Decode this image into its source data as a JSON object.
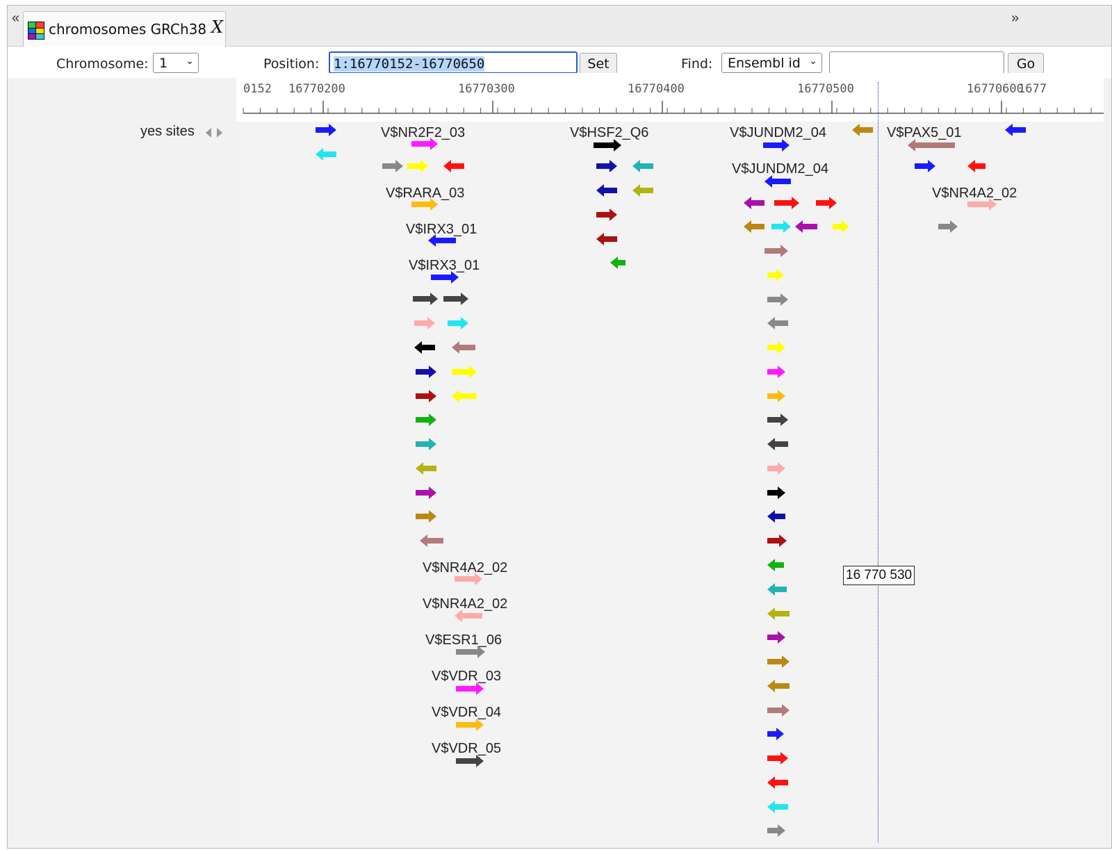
{
  "tab_bar": {
    "scroll_left": "«",
    "scroll_right": "»",
    "tab_title": "chromosomes GRCh38",
    "tab_close": "X"
  },
  "toolbar": {
    "chromosome_label": "Chromosome:",
    "chromosome_value": "1",
    "position_label": "Position:",
    "position_value": "1:16770152-16770650",
    "set_label": "Set",
    "find_label": "Find:",
    "find_type": "Ensembl id",
    "find_value": "",
    "go_label": "Go"
  },
  "ruler": {
    "ticks": [
      "0152",
      "16770200",
      "16770300",
      "16770400",
      "16770500",
      "16770600",
      "1677"
    ]
  },
  "track": {
    "label": "yes sites",
    "marker_label": "16 770 530"
  },
  "site_labels": [
    "V$NR2F2_03",
    "V$HSF2_Q6",
    "V$JUNDM2_04",
    "V$PAX5_01",
    "V$JUNDM2_04",
    "V$RARA_03",
    "V$NR4A2_02",
    "V$IRX3_01",
    "V$IRX3_01",
    "V$NR4A2_02",
    "V$NR4A2_02",
    "V$ESR1_06",
    "V$VDR_03",
    "V$VDR_04",
    "V$VDR_05"
  ],
  "colors": {
    "blue": "#1a1aff",
    "cyan": "#22e5f0",
    "magenta": "#ff1aff",
    "gray": "#888888",
    "yellow": "#ffff00",
    "red": "#ff1111",
    "orange": "#ffbb11",
    "black": "#000000",
    "navy": "#1111aa",
    "teal": "#22b3b3",
    "olive": "#b3b311",
    "darkred": "#aa1111",
    "green": "#11b311",
    "purple": "#aa11aa",
    "gold": "#bb8811",
    "rosy": "#b37a7a",
    "pink": "#ffaaaa",
    "darkgray": "#444444"
  }
}
